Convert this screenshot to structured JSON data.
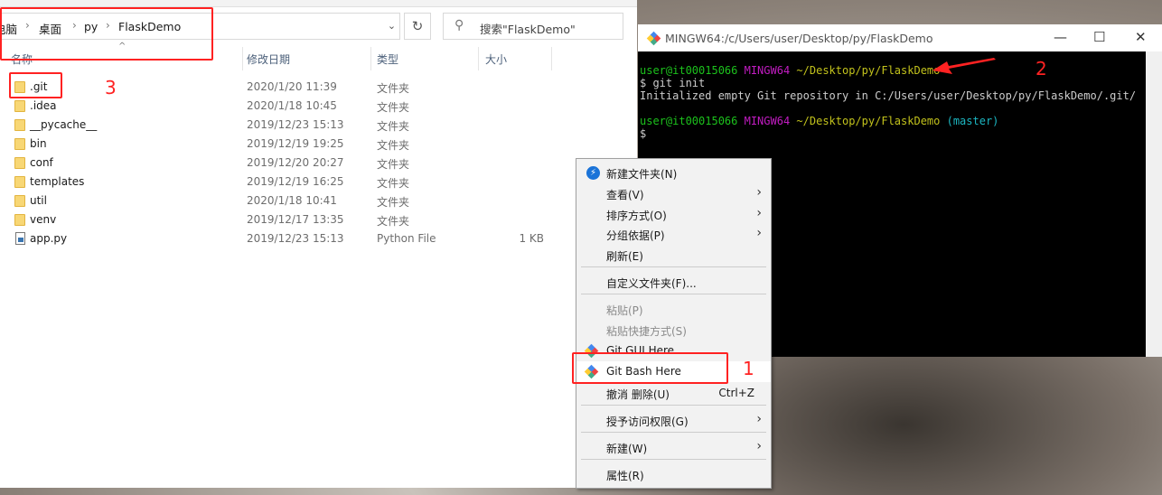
{
  "explorer": {
    "breadcrumb": [
      "电脑",
      "桌面",
      "py",
      "FlaskDemo"
    ],
    "search_placeholder": "搜索\"FlaskDemo\"",
    "columns": {
      "name": "名称",
      "date": "修改日期",
      "type": "类型",
      "size": "大小"
    },
    "files": [
      {
        "name": ".git",
        "date": "2020/1/20 11:39",
        "type": "文件夹",
        "size": "",
        "icon": "folder-icon"
      },
      {
        "name": ".idea",
        "date": "2020/1/18 10:45",
        "type": "文件夹",
        "size": "",
        "icon": "folder-icon"
      },
      {
        "name": "__pycache__",
        "date": "2019/12/23 15:13",
        "type": "文件夹",
        "size": "",
        "icon": "folder-icon"
      },
      {
        "name": "bin",
        "date": "2019/12/19 19:25",
        "type": "文件夹",
        "size": "",
        "icon": "folder-icon"
      },
      {
        "name": "conf",
        "date": "2019/12/20 20:27",
        "type": "文件夹",
        "size": "",
        "icon": "folder-icon"
      },
      {
        "name": "templates",
        "date": "2019/12/19 16:25",
        "type": "文件夹",
        "size": "",
        "icon": "folder-icon"
      },
      {
        "name": "util",
        "date": "2020/1/18 10:41",
        "type": "文件夹",
        "size": "",
        "icon": "folder-icon"
      },
      {
        "name": "venv",
        "date": "2019/12/17 13:35",
        "type": "文件夹",
        "size": "",
        "icon": "folder-icon"
      },
      {
        "name": "app.py",
        "date": "2019/12/23 15:13",
        "type": "Python File",
        "size": "1 KB",
        "icon": "python-file-icon"
      }
    ]
  },
  "terminal": {
    "title": "MINGW64:/c/Users/user/Desktop/py/FlaskDemo",
    "user": "user@it00015066",
    "env": "MINGW64",
    "path": "~/Desktop/py/FlaskDemo",
    "command": "$ git init",
    "output": "Initialized empty Git repository in C:/Users/user/Desktop/py/FlaskDemo/.git/",
    "branch": "(master)",
    "prompt": "$"
  },
  "context_menu": {
    "items": [
      {
        "label": "新建文件夹(N)"
      },
      {
        "label": "查看(V)"
      },
      {
        "label": "排序方式(O)"
      },
      {
        "label": "分组依据(P)"
      },
      {
        "label": "刷新(E)"
      },
      {
        "label": "自定义文件夹(F)..."
      },
      {
        "label": "粘贴(P)"
      },
      {
        "label": "粘贴快捷方式(S)"
      },
      {
        "label": "Git GUI Here"
      },
      {
        "label": "Git Bash Here"
      },
      {
        "label": "撤消 删除(U)",
        "shortcut": "Ctrl+Z"
      },
      {
        "label": "授予访问权限(G)"
      },
      {
        "label": "新建(W)"
      },
      {
        "label": "属性(R)"
      }
    ]
  },
  "annotations": {
    "a1": "1",
    "a2": "2",
    "a3": "3",
    "color": "#ff2222"
  }
}
